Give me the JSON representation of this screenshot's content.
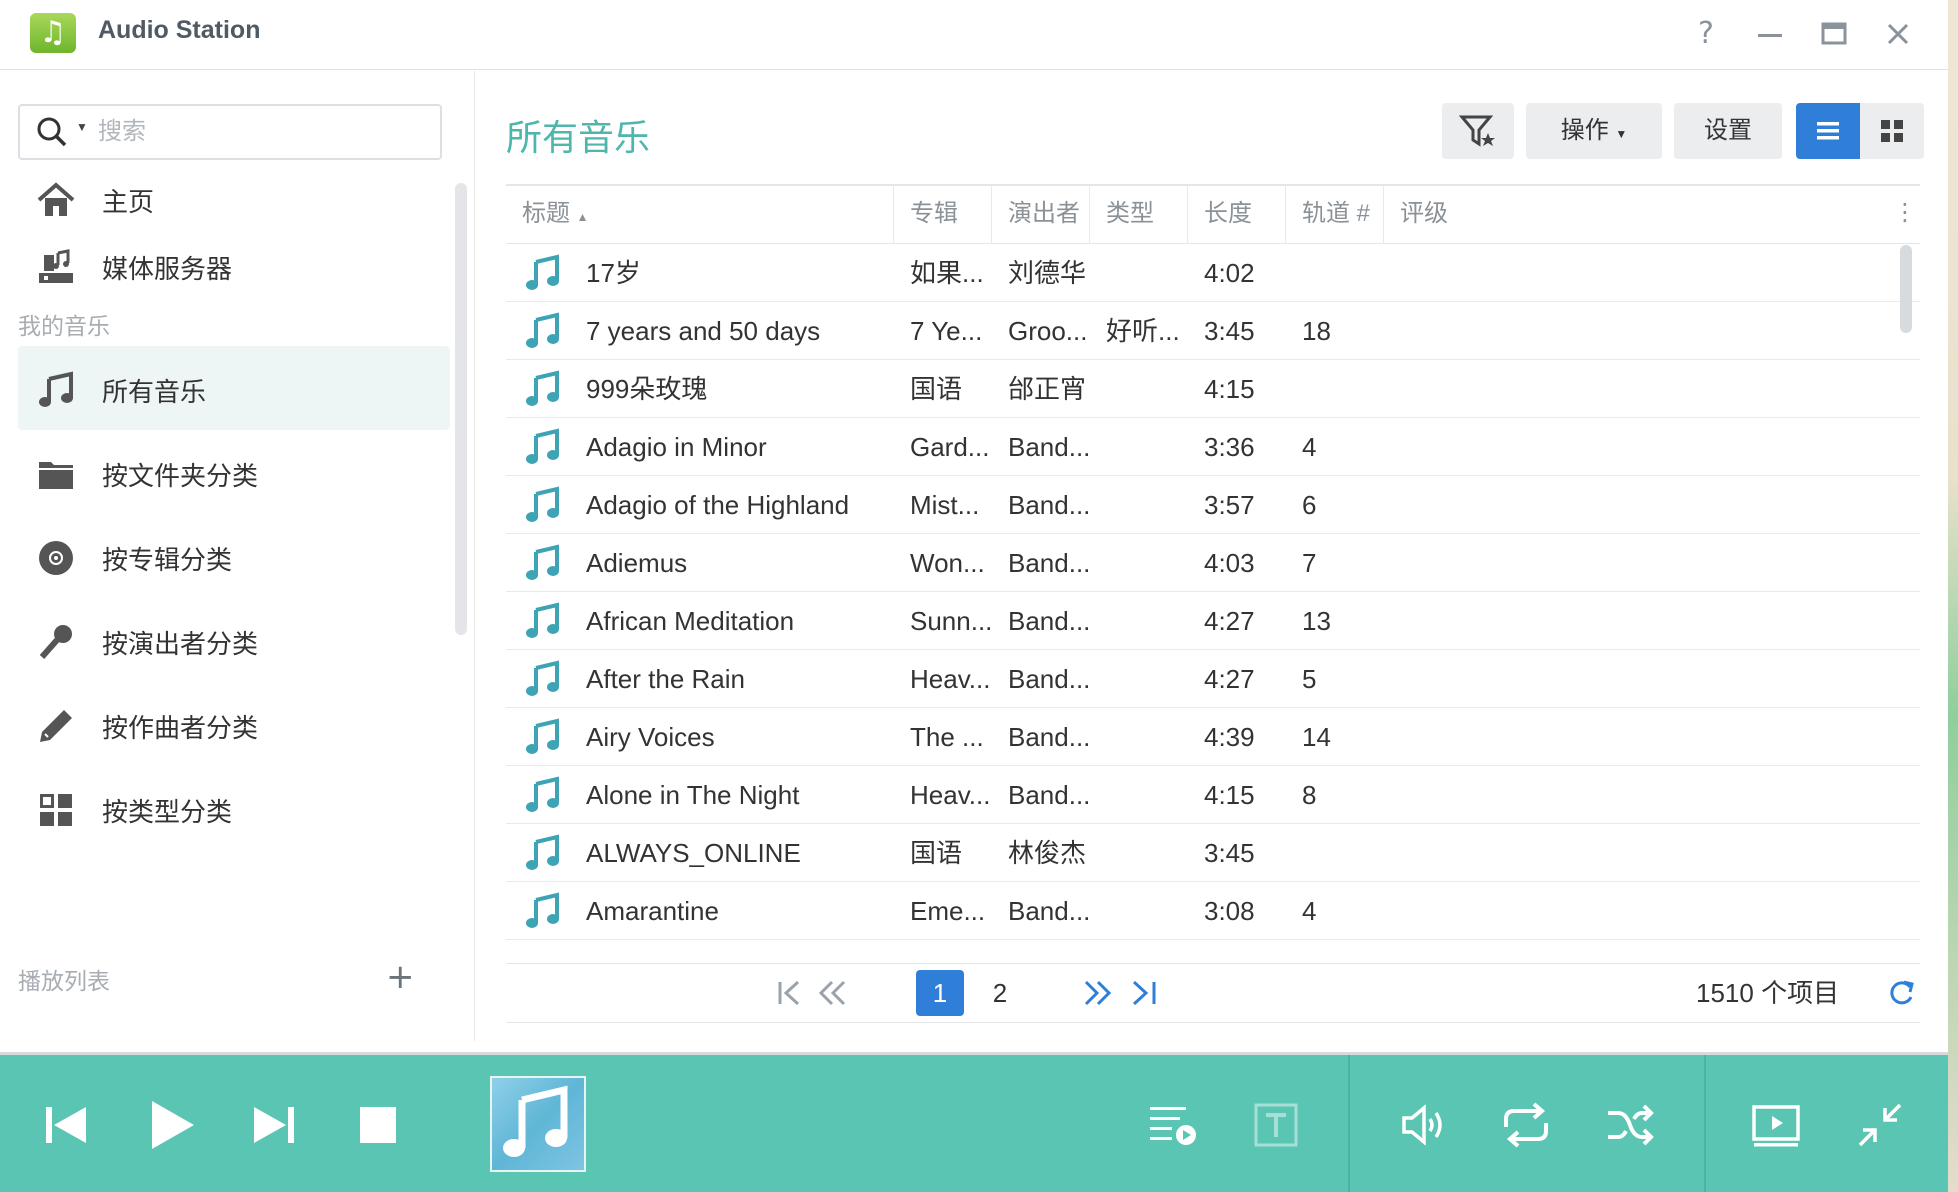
{
  "app": {
    "title": "Audio Station",
    "logo_icon": "music-note-icon"
  },
  "window_controls": {
    "help": "?",
    "minimize": "—",
    "maximize": "▭",
    "close": "✕"
  },
  "search": {
    "placeholder": "搜索"
  },
  "sidebar": {
    "top_items": [
      {
        "label": "主页",
        "icon": "home-icon"
      },
      {
        "label": "媒体服务器",
        "icon": "media-server-icon"
      }
    ],
    "my_music_title": "我的音乐",
    "music_items": [
      {
        "label": "所有音乐",
        "icon": "music-note-icon",
        "active": true
      },
      {
        "label": "按文件夹分类",
        "icon": "folder-icon"
      },
      {
        "label": "按专辑分类",
        "icon": "disc-icon"
      },
      {
        "label": "按演出者分类",
        "icon": "microphone-icon"
      },
      {
        "label": "按作曲者分类",
        "icon": "pen-icon"
      },
      {
        "label": "按类型分类",
        "icon": "grid-icon"
      }
    ],
    "playlist_title": "播放列表",
    "add_label": "+"
  },
  "main": {
    "title": "所有音乐",
    "toolbar": {
      "filter_icon": "filter-star-icon",
      "action_label": "操作",
      "settings_label": "设置",
      "list_view_icon": "list-view-icon",
      "grid_view_icon": "grid-view-icon"
    },
    "columns": [
      "标题",
      "专辑",
      "演出者",
      "类型",
      "长度",
      "轨道 #",
      "评级"
    ],
    "rows": [
      {
        "title": "17岁",
        "album": "如果...",
        "artist": "刘德华",
        "genre": "",
        "length": "4:02",
        "track": ""
      },
      {
        "title": "7 years and 50 days",
        "album": "7 Ye...",
        "artist": "Groo...",
        "genre": "好听...",
        "length": "3:45",
        "track": "18"
      },
      {
        "title": "999朵玫瑰",
        "album": "国语",
        "artist": "邰正宵",
        "genre": "",
        "length": "4:15",
        "track": ""
      },
      {
        "title": "Adagio in Minor",
        "album": "Gard...",
        "artist": "Band...",
        "genre": "",
        "length": "3:36",
        "track": "4"
      },
      {
        "title": "Adagio of the Highland",
        "album": "Mist...",
        "artist": "Band...",
        "genre": "",
        "length": "3:57",
        "track": "6"
      },
      {
        "title": "Adiemus",
        "album": "Won...",
        "artist": "Band...",
        "genre": "",
        "length": "4:03",
        "track": "7"
      },
      {
        "title": "African Meditation",
        "album": "Sunn...",
        "artist": "Band...",
        "genre": "",
        "length": "4:27",
        "track": "13"
      },
      {
        "title": "After the Rain",
        "album": "Heav...",
        "artist": "Band...",
        "genre": "",
        "length": "4:27",
        "track": "5"
      },
      {
        "title": "Airy Voices",
        "album": "The ...",
        "artist": "Band...",
        "genre": "",
        "length": "4:39",
        "track": "14"
      },
      {
        "title": "Alone in The Night",
        "album": "Heav...",
        "artist": "Band...",
        "genre": "",
        "length": "4:15",
        "track": "8"
      },
      {
        "title": "ALWAYS_ONLINE",
        "album": "国语",
        "artist": "林俊杰",
        "genre": "",
        "length": "3:45",
        "track": ""
      },
      {
        "title": "Amarantine",
        "album": "Eme...",
        "artist": "Band...",
        "genre": "",
        "length": "3:08",
        "track": "4"
      }
    ],
    "pagination": {
      "pages": [
        "1",
        "2"
      ],
      "current": "1",
      "total": "1510 个项目"
    }
  },
  "player": {
    "controls": [
      "previous-icon",
      "play-icon",
      "next-icon",
      "stop-icon"
    ],
    "right_controls": [
      "playlist-play-icon",
      "lyrics-icon",
      "volume-icon",
      "repeat-icon",
      "shuffle-icon",
      "video-mode-icon",
      "minimize-player-icon"
    ],
    "accent_color": "#5bc5b3",
    "brand_color": "#4fb6ab",
    "button_blue": "#2f7fd9"
  }
}
